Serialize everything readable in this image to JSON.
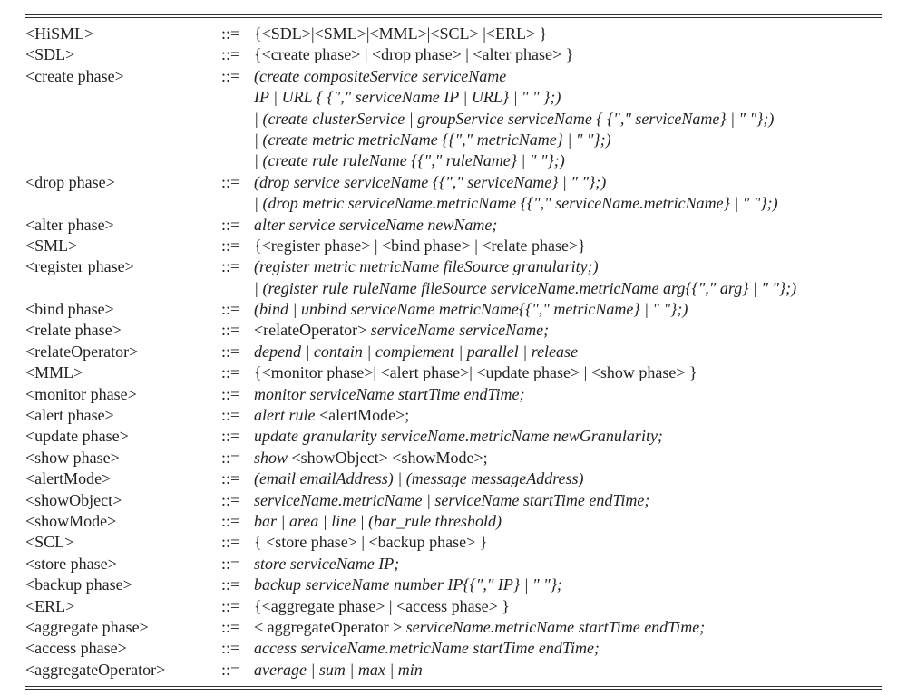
{
  "grammar": {
    "rows": [
      {
        "lhs": "<HiSML>",
        "op": "::=",
        "rhs": "{<SDL>|<SML>|<MML>|<SCL> |<ERL> }",
        "italic": false
      },
      {
        "lhs": "<SDL>",
        "op": "::=",
        "rhs": "{<create phase> | <drop phase> | <alter phase> }",
        "italic": false
      },
      {
        "lhs": "<create phase>",
        "op": "::=",
        "rhs": "(create compositeService serviceName",
        "italic": true
      },
      {
        "lhs": "",
        "op": "",
        "rhs": "IP | URL { {\",\" serviceName IP | URL} | \" \" };)",
        "italic": true
      },
      {
        "lhs": "",
        "op": "",
        "rhs": "| (create clusterService | groupService serviceName { {\",\" serviceName} | \" \"};)",
        "italic": true
      },
      {
        "lhs": "",
        "op": "",
        "rhs": "| (create metric metricName {{\",\" metricName} | \" \"};)",
        "italic": true
      },
      {
        "lhs": "",
        "op": "",
        "rhs": "| (create rule ruleName {{\",\" ruleName} | \" \"};)",
        "italic": true
      },
      {
        "lhs": "<drop phase>",
        "op": "::=",
        "rhs": "(drop service serviceName {{\",\" serviceName} | \" \"};)",
        "italic": true
      },
      {
        "lhs": "",
        "op": "",
        "rhs": "| (drop metric serviceName.metricName {{\",\" serviceName.metricName} | \" \"};)",
        "italic": true
      },
      {
        "lhs": "<alter phase>",
        "op": "::=",
        "rhs": "alter service serviceName newName;",
        "italic": true
      },
      {
        "lhs": "<SML>",
        "op": "::=",
        "rhs": "{<register phase> | <bind phase> | <relate phase>}",
        "italic": false
      },
      {
        "lhs": "<register phase>",
        "op": "::=",
        "rhs": "(register metric metricName fileSource granularity;)",
        "italic": true
      },
      {
        "lhs": "",
        "op": "",
        "rhs": "| (register rule ruleName fileSource serviceName.metricName arg{{\",\" arg} | \" \"};)",
        "italic": true
      },
      {
        "lhs": "<bind phase>",
        "op": "::=",
        "rhs": "(bind | unbind serviceName metricName{{\",\" metricName} | \" \"};)",
        "italic": true
      },
      {
        "lhs": "<relate phase>",
        "op": "::=",
        "rhs": "<relateOperator> serviceName serviceName;",
        "italic": true,
        "leadRoman": "<relateOperator> "
      },
      {
        "lhs": "<relateOperator>",
        "op": "::=",
        "rhs": "depend | contain | complement | parallel | release",
        "italic": true
      },
      {
        "lhs": "<MML>",
        "op": "::=",
        "rhs": "{<monitor phase>| <alert phase>| <update phase> | <show phase> }",
        "italic": false
      },
      {
        "lhs": "<monitor phase>",
        "op": "::=",
        "rhs": "monitor serviceName startTime endTime;",
        "italic": true
      },
      {
        "lhs": "<alert phase>",
        "op": "::=",
        "rhs": "alert rule <alertMode>;",
        "italic": true,
        "tailRoman": "<alertMode>;"
      },
      {
        "lhs": "<update phase>",
        "op": "::=",
        "rhs": "update granularity serviceName.metricName newGranularity;",
        "italic": true
      },
      {
        "lhs": "<show phase>",
        "op": "::=",
        "rhs": "show <showObject> <showMode>;",
        "italic": true,
        "tailRoman": "<showObject> <showMode>;"
      },
      {
        "lhs": "<alertMode>",
        "op": "::=",
        "rhs": "(email emailAddress) | (message messageAddress)",
        "italic": true
      },
      {
        "lhs": "<showObject>",
        "op": "::=",
        "rhs": "serviceName.metricName | serviceName startTime endTime;",
        "italic": true
      },
      {
        "lhs": "<showMode>",
        "op": "::=",
        "rhs": "bar | area | line | (bar_rule threshold)",
        "italic": true
      },
      {
        "lhs": "<SCL>",
        "op": "::=",
        "rhs": "{ <store phase> | <backup phase> }",
        "italic": false
      },
      {
        "lhs": "<store phase>",
        "op": "::=",
        "rhs": "store serviceName IP;",
        "italic": true
      },
      {
        "lhs": "<backup phase>",
        "op": "::=",
        "rhs": "backup serviceName number IP{{\",\" IP} | \" \"};",
        "italic": true
      },
      {
        "lhs": "<ERL>",
        "op": "::=",
        "rhs": "{<aggregate phase> | <access phase> }",
        "italic": false
      },
      {
        "lhs": "<aggregate phase>",
        "op": "::=",
        "rhs": "< aggregateOperator > serviceName.metricName startTime endTime;",
        "italic": true,
        "leadRoman": "< aggregateOperator > "
      },
      {
        "lhs": "<access phase>",
        "op": "::=",
        "rhs": "access serviceName.metricName startTime endTime;",
        "italic": true
      },
      {
        "lhs": "<aggregateOperator>",
        "op": "::=",
        "rhs": "average | sum | max | min",
        "italic": true
      }
    ]
  }
}
